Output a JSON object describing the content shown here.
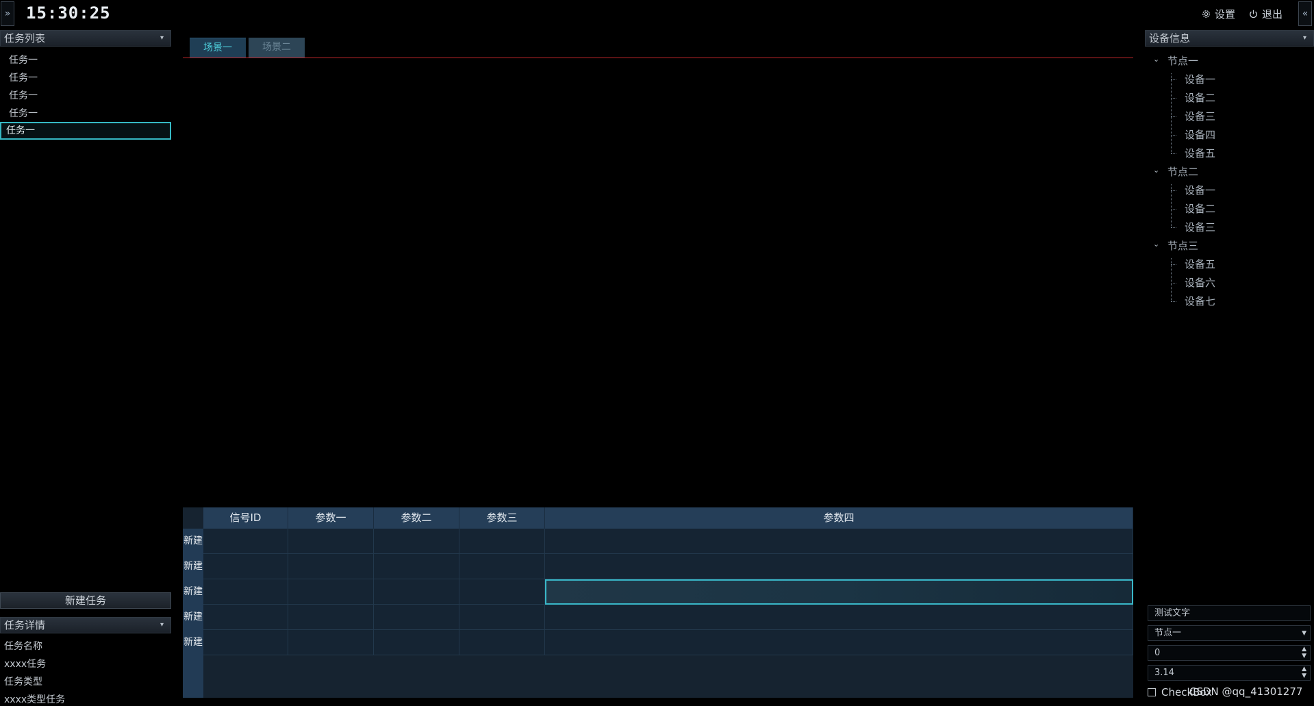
{
  "header": {
    "expand_glyph": "»",
    "collapse_glyph": "«",
    "clock": "15:30:25",
    "settings_label": "设置",
    "exit_label": "退出"
  },
  "task_list": {
    "title": "任务列表",
    "items": [
      "任务一",
      "任务一",
      "任务一",
      "任务一",
      "任务一"
    ],
    "selected_index": 4
  },
  "new_task_button": "新建任务",
  "task_details": {
    "title": "任务详情",
    "name_label": "任务名称",
    "name_value": "xxxx任务",
    "type_label": "任务类型",
    "type_value": "xxxx类型任务"
  },
  "tabs": [
    {
      "label": "场景一",
      "active": true
    },
    {
      "label": "场景二",
      "active": false
    }
  ],
  "table": {
    "columns": [
      "信号ID",
      "参数一",
      "参数二",
      "参数三",
      "参数四"
    ],
    "row_labels": [
      "新建",
      "新建",
      "新建",
      "新建",
      "新建"
    ],
    "active_cell": {
      "row": 2,
      "col": 4
    }
  },
  "device_info": {
    "title": "设备信息",
    "nodes": [
      {
        "label": "节点一",
        "children": [
          "设备一",
          "设备二",
          "设备三",
          "设备四",
          "设备五"
        ]
      },
      {
        "label": "节点二",
        "children": [
          "设备一",
          "设备二",
          "设备三"
        ]
      },
      {
        "label": "节点三",
        "children": [
          "设备五",
          "设备六",
          "设备七"
        ]
      }
    ]
  },
  "controls": {
    "text_field_value": "测试文字",
    "select_value": "节点一",
    "int_spin_value": "0",
    "double_spin_value": "3.14",
    "checkbox_label": "CheckBox",
    "checkbox_checked": false
  },
  "watermark": "CSDN @qq_41301277",
  "colors": {
    "accent_cyan": "#36b9c4",
    "tab_underline_red": "#c0262b",
    "table_header": "#253e58",
    "background": "#000000"
  }
}
